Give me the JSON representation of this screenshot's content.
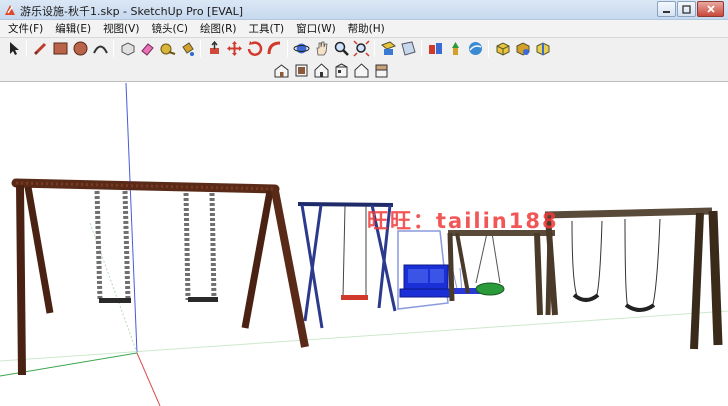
{
  "window": {
    "title": "游乐设施-秋千1.skp - SketchUp Pro [EVAL]"
  },
  "menu": {
    "items": [
      {
        "label": "文件(F)"
      },
      {
        "label": "编辑(E)"
      },
      {
        "label": "视图(V)"
      },
      {
        "label": "镜头(C)"
      },
      {
        "label": "绘图(R)"
      },
      {
        "label": "工具(T)"
      },
      {
        "label": "窗口(W)"
      },
      {
        "label": "帮助(H)"
      }
    ]
  },
  "toolbar": {
    "main_tools": [
      "select-icon",
      "pencil-icon",
      "rectangle-icon",
      "circle-icon",
      "arc-icon",
      "make-component-icon",
      "eraser-icon",
      "tape-measure-icon",
      "paint-bucket-icon",
      "push-pull-icon",
      "move-icon",
      "rotate-icon",
      "follow-me-icon",
      "orbit-icon",
      "pan-icon",
      "zoom-icon",
      "zoom-extents-icon",
      "section-plane-icon",
      "section-fill-icon",
      "get-models-icon",
      "share-model-icon",
      "warehouse-icon",
      "extension-warehouse-icon",
      "component-icon",
      "layout-icon",
      "send-icon"
    ],
    "view_tools": [
      "iso-view-icon",
      "top-view-icon",
      "front-view-icon",
      "right-view-icon",
      "back-view-icon",
      "left-view-icon"
    ]
  },
  "viewport": {
    "watermark": "旺旺：tailin188",
    "axis_colors": {
      "red": "#d94c4c",
      "green": "#3aa64a",
      "blue": "#4a5bd8"
    },
    "model_colors": {
      "wood": "#5a2a18",
      "chain": "#6f6f6f",
      "frame_blue": "#2b3a8c",
      "seat_blue": "#1a2fd6"
    }
  }
}
